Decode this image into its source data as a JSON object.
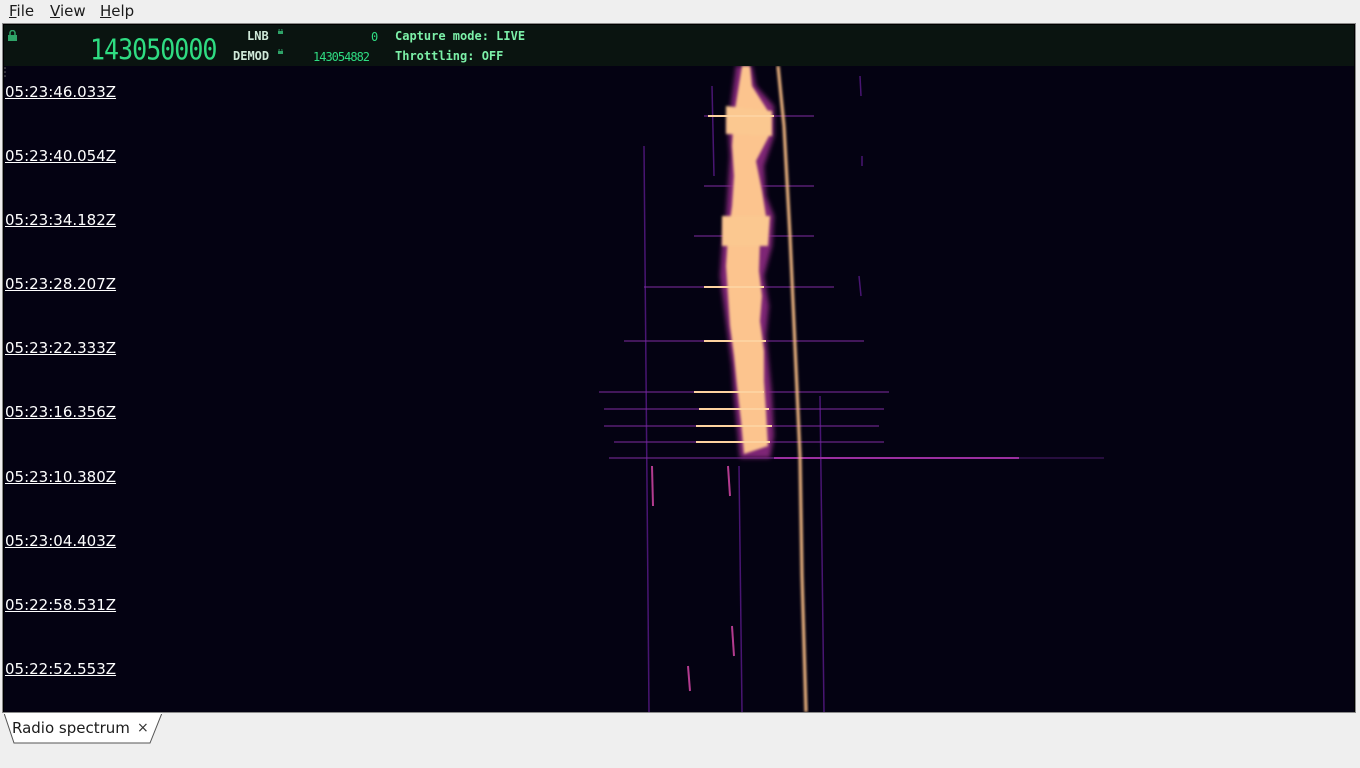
{
  "menu": {
    "items": [
      "File",
      "View",
      "Help"
    ]
  },
  "header": {
    "main_frequency": "143050000",
    "lnb_label": "LNB",
    "lnb_value": "0",
    "demod_label": "DEMOD",
    "demod_value": "143054882",
    "capture_mode": "Capture mode: LIVE",
    "throttling": "Throttling: OFF",
    "accent_color": "#2fdc82"
  },
  "waterfall": {
    "timestamps": [
      "05:23:46.033Z",
      "05:23:40.054Z",
      "05:23:34.182Z",
      "05:23:28.207Z",
      "05:23:22.333Z",
      "05:23:16.356Z",
      "05:23:10.380Z",
      "05:23:04.403Z",
      "05:22:58.531Z",
      "05:22:52.553Z"
    ],
    "colormap": [
      "#040212",
      "#3b0f70",
      "#8c2981",
      "#de4968",
      "#fe9f6d",
      "#fcd5a0"
    ]
  },
  "tabs": [
    {
      "label": "Radio spectrum",
      "close": "×"
    }
  ]
}
